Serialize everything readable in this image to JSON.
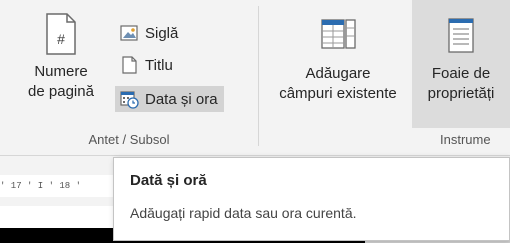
{
  "ribbon": {
    "header_footer_group": {
      "label": "Antet / Subsol",
      "page_numbers": {
        "line1": "Numere",
        "line2": "de pagină",
        "icon": "page-number-icon"
      },
      "logo": {
        "label": "Siglă",
        "icon": "logo-picture-icon"
      },
      "title": {
        "label": "Titlu",
        "icon": "title-page-icon"
      },
      "date_time": {
        "label": "Data și ora",
        "icon": "calendar-clock-icon"
      }
    },
    "tools_group": {
      "label": "Instrume",
      "add_existing_fields": {
        "line1": "Adăugare",
        "line2": "câmpuri existente",
        "icon": "add-fields-icon"
      },
      "property_sheet": {
        "line1": "Foaie de",
        "line2": "proprietăți",
        "icon": "property-sheet-icon"
      }
    }
  },
  "ruler": {
    "text": "' 17 ' I ' 18 '"
  },
  "tooltip": {
    "title": "Dată și oră",
    "description": "Adăugați rapid data sau ora curentă."
  },
  "colors": {
    "ribbon_bg": "#f3f3f3",
    "hover_bg": "#dcdcdc",
    "pressed_bg": "#d3d3d3",
    "icon_blue": "#2b6cb0",
    "document_dark": "#000000"
  }
}
